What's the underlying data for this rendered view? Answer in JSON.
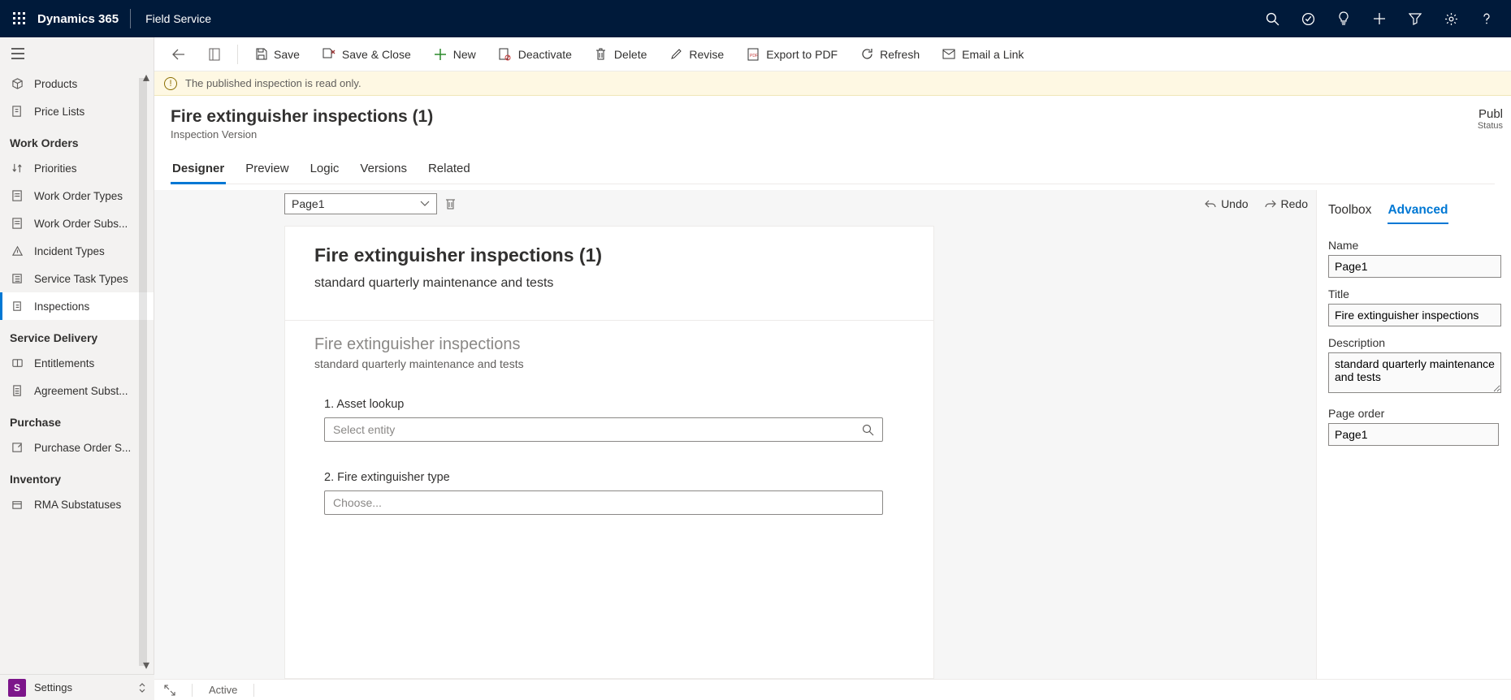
{
  "topbar": {
    "brand": "Dynamics 365",
    "app": "Field Service"
  },
  "nav": {
    "plain_top": [
      {
        "icon": "cube",
        "label": "Products"
      },
      {
        "icon": "tag",
        "label": "Price Lists"
      }
    ],
    "groups": [
      {
        "title": "Work Orders",
        "items": [
          {
            "icon": "sort",
            "label": "Priorities"
          },
          {
            "icon": "form",
            "label": "Work Order Types"
          },
          {
            "icon": "form",
            "label": "Work Order Subs..."
          },
          {
            "icon": "warn",
            "label": "Incident Types"
          },
          {
            "icon": "list",
            "label": "Service Task Types"
          },
          {
            "icon": "inspect",
            "label": "Inspections",
            "selected": true
          }
        ]
      },
      {
        "title": "Service Delivery",
        "items": [
          {
            "icon": "ticket",
            "label": "Entitlements"
          },
          {
            "icon": "doc",
            "label": "Agreement Subst..."
          }
        ]
      },
      {
        "title": "Purchase",
        "items": [
          {
            "icon": "cart",
            "label": "Purchase Order S..."
          }
        ]
      },
      {
        "title": "Inventory",
        "items": [
          {
            "icon": "box",
            "label": "RMA Substatuses"
          }
        ]
      }
    ]
  },
  "settings": {
    "badge": "S",
    "label": "Settings"
  },
  "cmd": {
    "save": "Save",
    "save_close": "Save & Close",
    "new": "New",
    "deactivate": "Deactivate",
    "delete": "Delete",
    "revise": "Revise",
    "export_pdf": "Export to PDF",
    "refresh": "Refresh",
    "email_link": "Email a Link"
  },
  "warning": "The published inspection is read only.",
  "record": {
    "title": "Fire extinguisher inspections (1)",
    "subtitle": "Inspection Version",
    "status_value": "Publ",
    "status_label": "Status"
  },
  "tabs": [
    "Designer",
    "Preview",
    "Logic",
    "Versions",
    "Related"
  ],
  "active_tab": "Designer",
  "designer": {
    "page_selector": "Page1",
    "undo": "Undo",
    "redo": "Redo",
    "survey": {
      "title": "Fire extinguisher inspections (1)",
      "desc": "standard quarterly maintenance and tests",
      "section_title": "Fire extinguisher inspections",
      "section_desc": "standard quarterly maintenance and tests",
      "q1": {
        "label": "1. Asset lookup",
        "placeholder": "Select entity"
      },
      "q2": {
        "label": "2. Fire extinguisher type",
        "placeholder": "Choose..."
      }
    }
  },
  "props": {
    "tab_toolbox": "Toolbox",
    "tab_advanced": "Advanced",
    "name_label": "Name",
    "name_value": "Page1",
    "title_label": "Title",
    "title_value": "Fire extinguisher inspections",
    "desc_label": "Description",
    "desc_value": "standard quarterly maintenance and tests",
    "order_label": "Page order",
    "order_value": "Page1"
  },
  "statusbar": {
    "state": "Active"
  }
}
